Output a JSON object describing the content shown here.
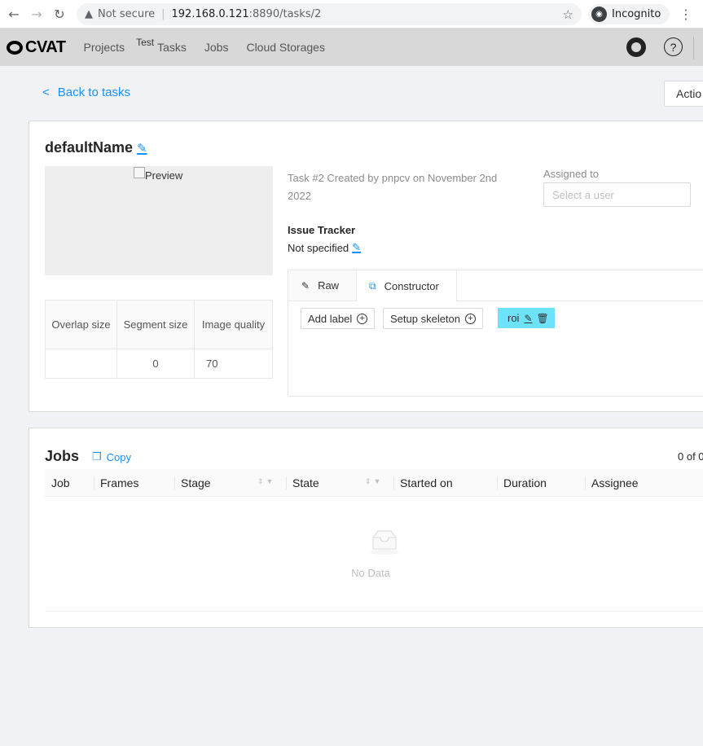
{
  "browser": {
    "security": "Not secure",
    "host": "192.168.0.121",
    "path": ":8890/tasks/2",
    "incognito": "Incognito"
  },
  "header": {
    "logo": "CVAT",
    "nav": [
      "Projects",
      "Test",
      "Tasks",
      "Jobs",
      "Cloud Storages"
    ]
  },
  "page": {
    "back": "Back to tasks",
    "actions": "Actio"
  },
  "task": {
    "name": "defaultName",
    "preview_label": "Preview",
    "created": "Task #2 Created by pnpcv on November 2nd 2022",
    "assigned_label": "Assigned to",
    "assigned_placeholder": "Select a user",
    "issue_label": "Issue Tracker",
    "issue_value": "Not specified",
    "table": {
      "headers": [
        "Overlap size",
        "Segment size",
        "Image quality"
      ],
      "values": [
        "",
        "0",
        "70"
      ]
    },
    "tabs": [
      "Raw",
      "Constructor"
    ],
    "add_label": "Add label",
    "setup_skeleton": "Setup skeleton",
    "labels": [
      "roi"
    ],
    "colors": {
      "label": "#6ce2fb",
      "accent": "#1890ff"
    }
  },
  "jobs": {
    "title": "Jobs",
    "copy": "Copy",
    "count": "0 of 0",
    "columns": [
      "Job",
      "Frames",
      "Stage",
      "State",
      "Started on",
      "Duration",
      "Assignee"
    ],
    "empty": "No Data"
  }
}
